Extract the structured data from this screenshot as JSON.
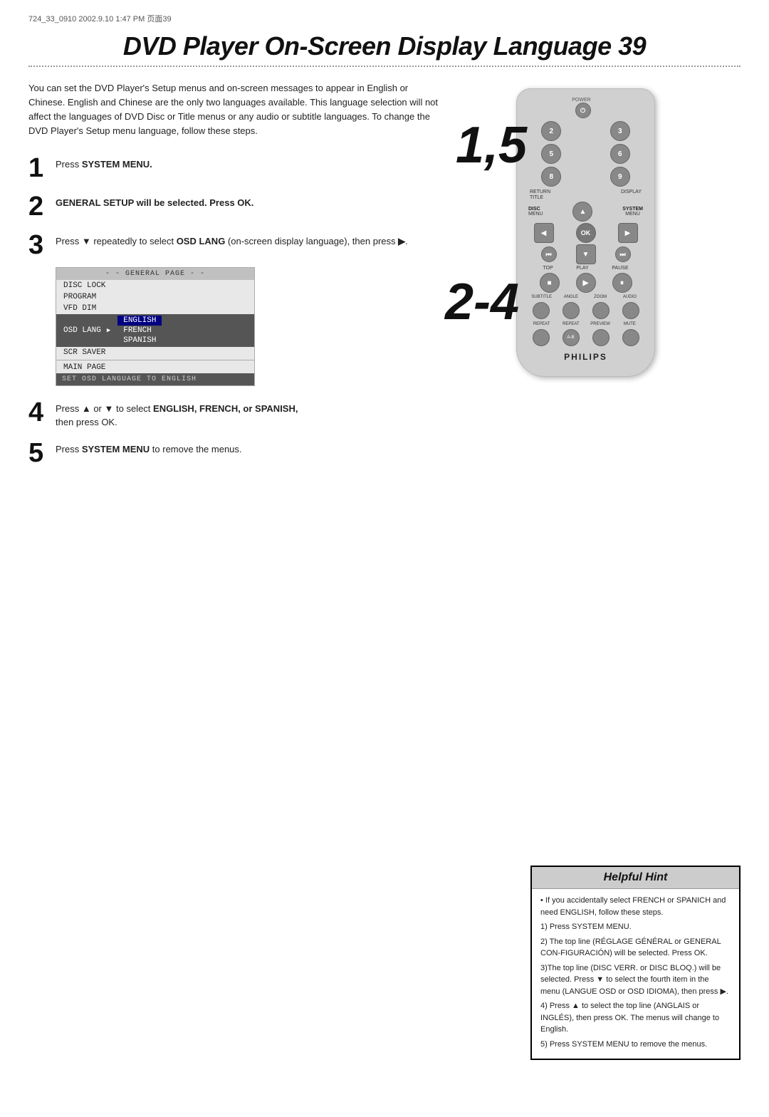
{
  "header": {
    "meta": "724_33_0910  2002.9.10  1:47 PM  页面39"
  },
  "title": "DVD Player On-Screen Display Language  39",
  "intro": "You can set the DVD Player's Setup menus and on-screen messages to appear in English or Chinese. English and Chinese are the only two languages available. This language selection will not affect the languages of DVD Disc or Title menus or any audio or subtitle languages. To change the DVD Player's Setup menu language, follow these steps.",
  "steps": [
    {
      "number": "1",
      "text": "Press SYSTEM MENU."
    },
    {
      "number": "2",
      "text": "GENERAL SETUP will be selected. Press OK."
    },
    {
      "number": "3",
      "text": "Press ▼ repeatedly to select OSD LANG (on-screen display language), then press ▶."
    },
    {
      "number": "4",
      "text": "Press ▲ or ▼ to select ENGLISH, FRENCH, or SPANISH, then press OK."
    },
    {
      "number": "5",
      "text": "Press SYSTEM MENU to remove the menus."
    }
  ],
  "menu": {
    "header": "- -  GENERAL PAGE  - -",
    "items": [
      "DISC LOCK",
      "PROGRAM",
      "VFD DIM",
      "OSD LANG",
      "SCR SAVER",
      "MAIN PAGE"
    ],
    "languages": [
      "ENGLISH",
      "FRENCH",
      "SPANISH"
    ],
    "footer": "SET OSD LANGUAGE TO ENGLISH"
  },
  "remote": {
    "power_label": "POWER",
    "numbers": [
      "2",
      "3",
      "5",
      "6",
      "8",
      "9"
    ],
    "labels_row1": [
      "RETURN",
      "",
      "DISPLAY"
    ],
    "labels_row2": [
      "TITLE",
      "",
      ""
    ],
    "disc_label": "DISC",
    "system_label": "SYSTEM",
    "menu_label": "MENU",
    "ok_label": "OK",
    "playback_labels": [
      "TOP",
      "PLAY",
      "PAUSE"
    ],
    "stop_sym": "■",
    "play_sym": "▶",
    "pause_sym": "⏸",
    "bottom_labels": [
      "SUBTITLE",
      "ANGLE",
      "ZOOM",
      "AUDIO",
      "REPEAT",
      "REPEAT",
      "PREVIEW",
      "MUTE"
    ],
    "ab_label": "A-B",
    "philips": "PHILIPS"
  },
  "step_overlays": {
    "top": "1,5",
    "bottom": "2-4"
  },
  "hint": {
    "title": "Helpful Hint",
    "bullet": "If you accidentally select FRENCH or SPANICH and need ENGLISH, follow these steps.",
    "steps": [
      "1) Press SYSTEM MENU.",
      "2) The top line (RÉGLAGE GÉNÉRAL or GENERAL CON-FIGURACIÓN) will be selected. Press OK.",
      "3) The top line (DISC VERR. or DISC BLOQ.) will be selected. Press ▼ to select the fourth item in the menu (LANGUE OSD or OSD IDIOMA), then press ▶.",
      "4) Press ▲ to select the top line (ANGLAIS or INGLÉS), then press OK. The menus will change to English.",
      "5) Press SYSTEM MENU to remove the menus."
    ]
  }
}
